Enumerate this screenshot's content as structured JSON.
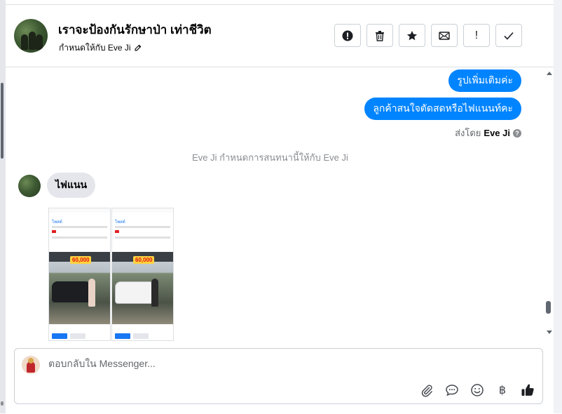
{
  "conversation": {
    "title": "เราจะป้องกันรักษาป่า เท่าชีวิต",
    "assigned_text": "กำหนดให้กับ Eve Ji",
    "actions": [
      {
        "name": "report-button",
        "icon": "alert-circle-icon"
      },
      {
        "name": "delete-button",
        "icon": "trash-icon"
      },
      {
        "name": "star-button",
        "icon": "star-icon"
      },
      {
        "name": "mark-unread-button",
        "icon": "envelope-icon"
      },
      {
        "name": "follow-up-button",
        "icon": "exclamation-icon",
        "glyph": "!"
      },
      {
        "name": "mark-done-button",
        "icon": "check-icon"
      }
    ]
  },
  "messages": {
    "outgoing": [
      "รูปเพิ่มเติมค่ะ",
      "ลูกค้าสนใจตัดสดหรือไฟแนนท์คะ"
    ],
    "sent_by_label": "ส่งโดย",
    "sent_by_name": "Eve Ji",
    "help_glyph": "?",
    "system_message": "Eve Ji กำหนดการสนทนานี้ให้กับ Eve Ji",
    "incoming_text": "ไฟแนน",
    "attachments": [
      {
        "tab": "โพสต์",
        "price_badge": "60,000",
        "car": "black"
      },
      {
        "tab": "โพสต์",
        "price_badge": "60,000",
        "car": "white"
      }
    ]
  },
  "composer": {
    "placeholder": "ตอบกลับใน Messenger...",
    "currency_glyph": "฿",
    "tools": [
      "paperclip-icon",
      "speech-bubble-icon",
      "smiley-icon",
      "baht-icon",
      "thumbs-up-icon"
    ]
  },
  "colors": {
    "accent_blue": "#0084ff",
    "incoming_bubble": "#e4e6eb",
    "muted_text": "#8a8d91"
  }
}
